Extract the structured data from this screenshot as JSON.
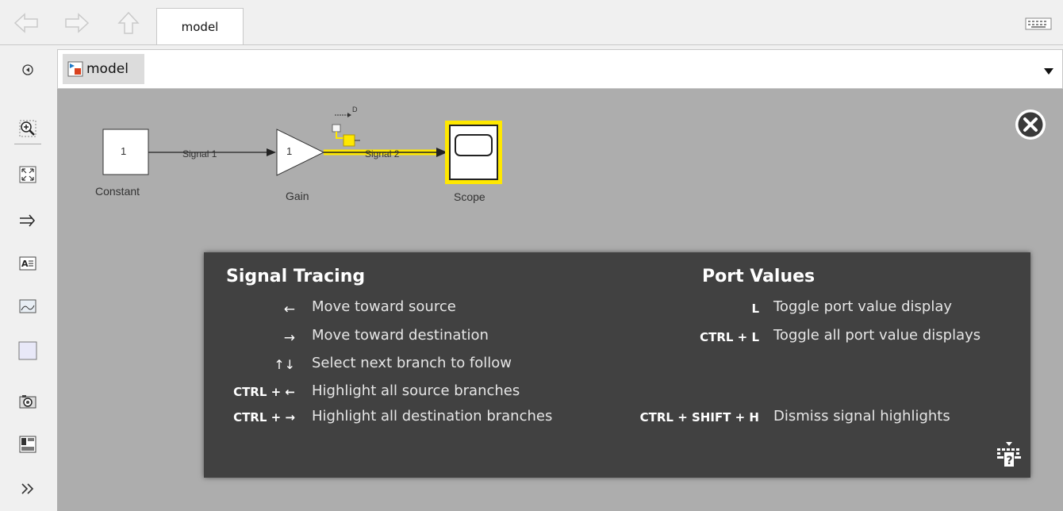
{
  "tab": {
    "label": "model"
  },
  "address": {
    "crumb": "model"
  },
  "diagram": {
    "blocks": {
      "constant": {
        "value": "1",
        "name": "Constant"
      },
      "gain": {
        "value": "1",
        "name": "Gain"
      },
      "scope": {
        "name": "Scope"
      }
    },
    "signals": {
      "s1": "Signal 1",
      "s2": "Signal 2"
    },
    "port_value_tag": "D"
  },
  "help": {
    "left_title": "Signal Tracing",
    "right_title": "Port Values",
    "left_rows": [
      {
        "key": "←",
        "desc": "Move toward source"
      },
      {
        "key": "→",
        "desc": "Move toward destination"
      },
      {
        "key": "↑↓",
        "desc": "Select next branch to follow"
      },
      {
        "key": "CTRL + ←",
        "desc": "Highlight all source branches"
      },
      {
        "key": "CTRL + →",
        "desc": "Highlight all destination branches"
      }
    ],
    "right_rows": [
      {
        "key": "L",
        "desc": "Toggle port value display"
      },
      {
        "key": "CTRL + L",
        "desc": "Toggle all port value displays"
      },
      {
        "key": "CTRL + SHIFT + H",
        "desc": "Dismiss signal highlights"
      }
    ]
  },
  "icons": [
    "back-arrow-icon",
    "forward-arrow-icon",
    "up-arrow-icon",
    "keyboard-icon",
    "hide-browser-icon",
    "zoom-icon",
    "fit-view-icon",
    "signal-lines-icon",
    "annotation-icon",
    "image-icon",
    "area-icon",
    "camera-icon",
    "report-icon",
    "more-icon",
    "close-icon",
    "keyboard-help-icon"
  ],
  "colors": {
    "highlight": "#ffe800",
    "canvas": "#adadad",
    "overlay": "#414141"
  }
}
